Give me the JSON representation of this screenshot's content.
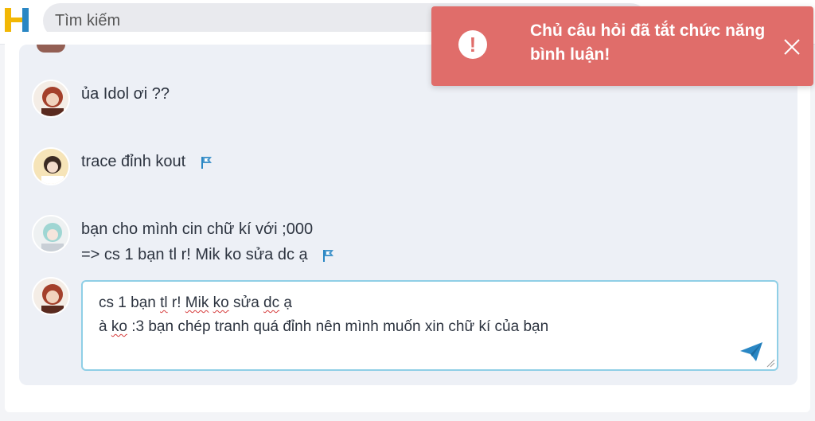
{
  "search": {
    "placeholder": "Tìm kiếm"
  },
  "comments": [
    {
      "text": "ủa Idol ơi ??",
      "flag": false
    },
    {
      "text": "trace đỉnh kout",
      "flag": true
    },
    {
      "lines": [
        "bạn cho mình cin chữ kí với ;000",
        "=> cs 1 bạn tl r! Mik ko sửa dc ạ"
      ],
      "flag": true
    }
  ],
  "reply": {
    "line1": [
      " cs 1 bạn ",
      "tl",
      " r! ",
      "Mik",
      " ",
      "ko",
      " sửa ",
      "dc",
      " ạ"
    ],
    "line2": [
      "à ",
      "ko",
      " :3 bạn chép tranh quá đỉnh nên mình muốn xin chữ kí của bạn"
    ]
  },
  "toast": {
    "message": "Chủ câu hỏi đã tắt chức năng bình luận!",
    "icon": "exclamation-icon"
  },
  "colors": {
    "toast_bg": "#e06d6a",
    "accent": "#2a87c4",
    "input_border": "#8fcfe6"
  }
}
